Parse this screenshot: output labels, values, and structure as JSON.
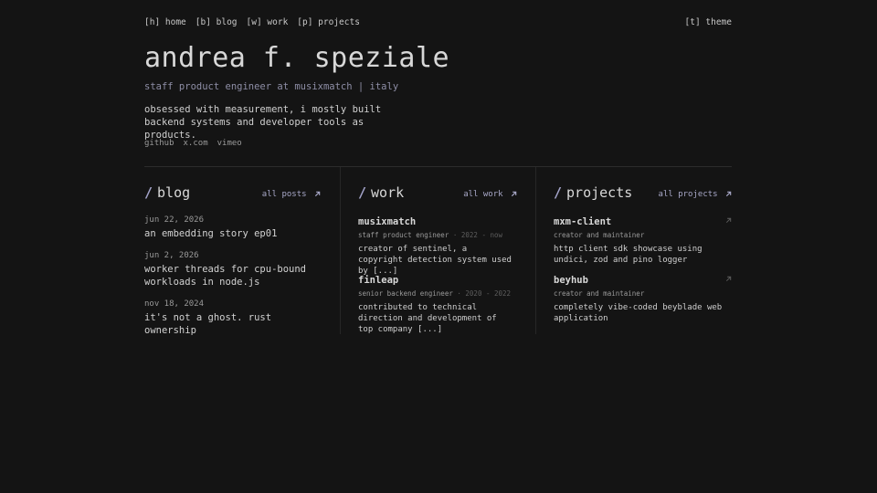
{
  "nav": {
    "items": [
      {
        "label": "[h] home"
      },
      {
        "label": "[b] blog"
      },
      {
        "label": "[w] work"
      },
      {
        "label": "[p] projects"
      }
    ],
    "theme_label": "[t] theme"
  },
  "hero": {
    "name": "andrea f. speziale",
    "subtitle": "staff product engineer at musixmatch | italy",
    "bio": "obsessed with measurement, i mostly built backend systems and developer tools as products.",
    "social": [
      {
        "label": "github"
      },
      {
        "label": "x.com"
      },
      {
        "label": "vimeo"
      }
    ]
  },
  "blog": {
    "title": "blog",
    "all_label": "all posts",
    "posts": [
      {
        "date": "jun 22, 2026",
        "title": "an embedding story ep01"
      },
      {
        "date": "jun 2, 2026",
        "title": "worker threads for cpu-bound workloads in node.js"
      },
      {
        "date": "nov 18, 2024",
        "title": "it's not a ghost. rust ownership"
      }
    ]
  },
  "work": {
    "title": "work",
    "all_label": "all work",
    "jobs": [
      {
        "company": "musixmatch",
        "role": "staff product engineer",
        "years": "· 2022 - now",
        "description": "creator of sentinel, a copyright detection system used by [...]"
      },
      {
        "company": "finleap",
        "role": "senior backend engineer",
        "years": "· 2020 - 2022",
        "description": "contributed to technical direction and development of top company [...]"
      }
    ]
  },
  "projects": {
    "title": "projects",
    "all_label": "all projects",
    "items": [
      {
        "name": "mxm-client",
        "role": "creator and maintainer",
        "description": "http client sdk showcase using undici, zod and pino logger"
      },
      {
        "name": "beyhub",
        "role": "creator and maintainer",
        "description": "completely vibe-coded beyblade web application"
      }
    ]
  },
  "colors": {
    "background": "#141414",
    "accent": "#a3a3c9",
    "text": "#d4d4d4",
    "muted": "#9a9a9a"
  },
  "slash_glyph": "/"
}
